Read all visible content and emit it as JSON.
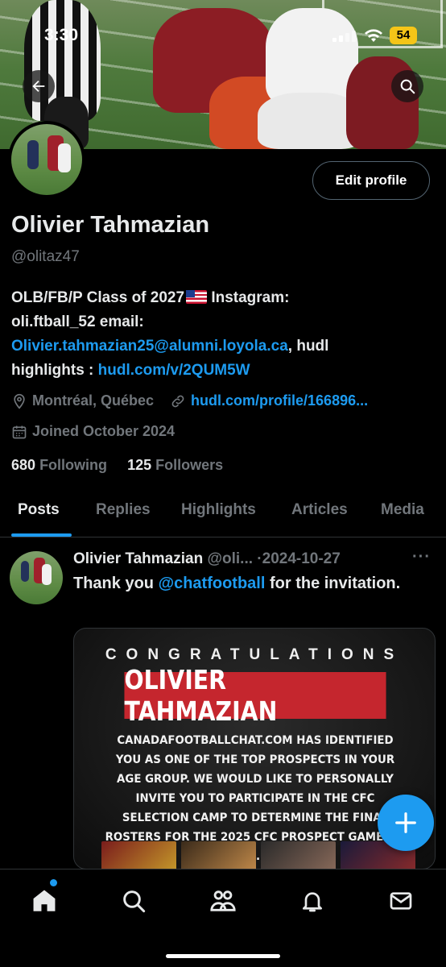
{
  "status_bar": {
    "time": "3:30",
    "battery": "54"
  },
  "profile": {
    "name": "Olivier Tahmazian",
    "handle": "@olitaz47",
    "edit_profile_label": "Edit profile",
    "bio": {
      "line1": "OLB/FB/P Class of 2027",
      "line1b": " Instagram:",
      "line2": "oli.ftball_52 email:",
      "email_link": "Olivier.tahmazian25@alumni.loyola.ca",
      "after_email": ", hudl",
      "highlights_prefix": "highlights : ",
      "hudl_link": "hudl.com/v/2QUM5W"
    },
    "location": "Montréal, Québec",
    "website": "hudl.com/profile/166896...",
    "joined": "Joined October 2024",
    "following_count": "680",
    "following_label": "Following",
    "followers_count": "125",
    "followers_label": "Followers"
  },
  "tabs": [
    {
      "label": "Posts",
      "active": true
    },
    {
      "label": "Replies"
    },
    {
      "label": "Highlights"
    },
    {
      "label": "Articles"
    },
    {
      "label": "Media"
    }
  ],
  "post": {
    "author": "Olivier Tahmazian",
    "handle": "@oli...",
    "separator": "·",
    "date": "2024-10-27",
    "more": "···",
    "text_prefix": "Thank you ",
    "mention": "@chatfootball",
    "text_suffix": " for the invitation.",
    "media": {
      "heading": "CONGRATULATIONS",
      "name": "OLIVIER TAHMAZIAN",
      "body": "CANADAFOOTBALLCHAT.COM HAS IDENTIFIED YOU AS ONE OF THE TOP PROSPECTS IN YOUR AGE GROUP. WE WOULD LIKE TO PERSONALLY INVITE YOU TO PARTICIPATE IN THE CFC SELECTION CAMP TO DETERMINE THE FINAL ROSTERS FOR THE 2025 CFC PROSPECT GAME ON T..."
    }
  },
  "fab": {
    "icon": "plus-icon"
  },
  "bottom_nav": [
    {
      "icon": "home-icon",
      "active": true
    },
    {
      "icon": "search-icon"
    },
    {
      "icon": "communities-icon"
    },
    {
      "icon": "notifications-icon"
    },
    {
      "icon": "messages-icon"
    }
  ],
  "colors": {
    "accent": "#1d9bf0",
    "muted": "#71767b",
    "text": "#e7e9ea",
    "banner_red": "#c5262e"
  }
}
